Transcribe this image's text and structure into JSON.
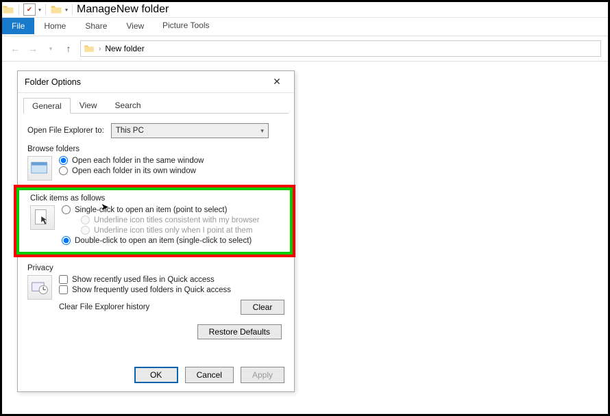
{
  "qat": {
    "dropdown_glyph": "▾"
  },
  "ribbon": {
    "file": "File",
    "home": "Home",
    "share": "Share",
    "view": "View",
    "picture_tools": "Picture Tools",
    "manage": "Manage",
    "context_title": "New folder"
  },
  "addr": {
    "folder": "New folder"
  },
  "dialog": {
    "title": "Folder Options",
    "tabs": {
      "general": "General",
      "view": "View",
      "search": "Search"
    },
    "open_label": "Open File Explorer to:",
    "open_value": "This PC",
    "browse": {
      "title": "Browse folders",
      "same": "Open each folder in the same window",
      "own": "Open each folder in its own window"
    },
    "click": {
      "title": "Click items as follows",
      "single": "Single-click to open an item (point to select)",
      "underline_always": "Underline icon titles consistent with my browser",
      "underline_point": "Underline icon titles only when I point at them",
      "double": "Double-click to open an item (single-click to select)"
    },
    "privacy": {
      "title": "Privacy",
      "recent": "Show recently used files in Quick access",
      "frequent": "Show frequently used folders in Quick access",
      "clear_label": "Clear File Explorer history",
      "clear_btn": "Clear"
    },
    "restore": "Restore Defaults",
    "ok": "OK",
    "cancel": "Cancel",
    "apply": "Apply"
  }
}
